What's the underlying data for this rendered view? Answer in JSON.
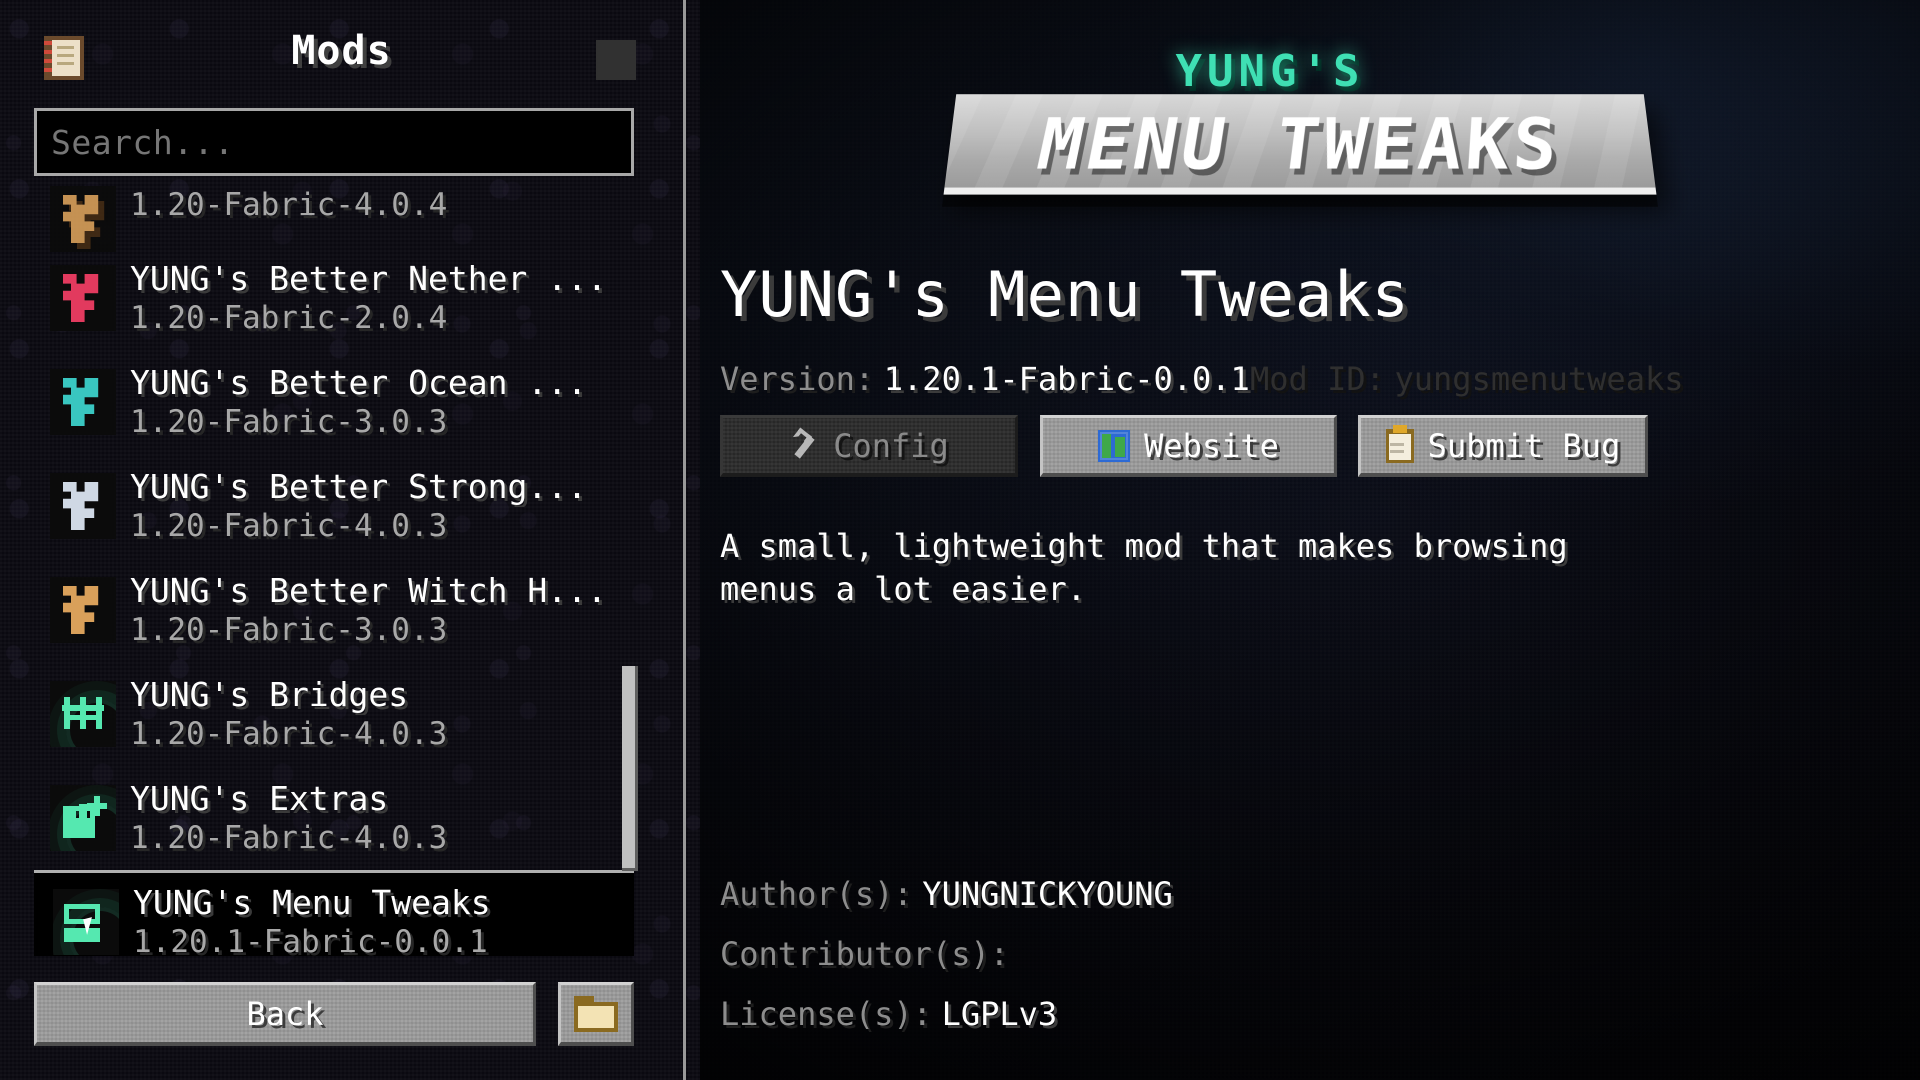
{
  "sidebar": {
    "title": "Mods",
    "book_icon": "book-icon",
    "header_toggle": "toggle-button",
    "search": {
      "placeholder": "Search...",
      "value": ""
    },
    "partial_top_row": {
      "version": "1.20-Fabric-4.0.4"
    },
    "mods": [
      {
        "name": "YUNG's Better Nether ...",
        "version": "1.20-Fabric-2.0.4",
        "icon": "yung-logo-icon",
        "c1": "#e23a5e",
        "c2": "#7d1028",
        "selected": false
      },
      {
        "name": "YUNG's Better Ocean ...",
        "version": "1.20-Fabric-3.0.3",
        "icon": "yung-logo-icon",
        "c1": "#39c6c0",
        "c2": "#12575c",
        "selected": false
      },
      {
        "name": "YUNG's Better Strong...",
        "version": "1.20-Fabric-4.0.3",
        "icon": "yung-logo-icon",
        "c1": "#cfd8e4",
        "c2": "#5a6a80",
        "selected": false
      },
      {
        "name": "YUNG's Better Witch H...",
        "version": "1.20-Fabric-3.0.3",
        "icon": "yung-logo-icon",
        "c1": "#d9a05a",
        "c2": "#74481e",
        "selected": false
      },
      {
        "name": "YUNG's Bridges",
        "version": "1.20-Fabric-4.0.3",
        "icon": "bridge-icon",
        "c1": "#55e8b0",
        "c2": "#1a6b50",
        "selected": false
      },
      {
        "name": "YUNG's Extras",
        "version": "1.20-Fabric-4.0.3",
        "icon": "extras-icon",
        "c1": "#55e8b0",
        "c2": "#1a6b50",
        "selected": false
      },
      {
        "name": "YUNG's Menu Tweaks",
        "version": "1.20.1-Fabric-0.0.1",
        "icon": "menu-tweaks-icon",
        "c1": "#55e8b0",
        "c2": "#1a6b50",
        "selected": true
      }
    ],
    "back_label": "Back",
    "folder_button": "open-mods-folder-button",
    "scrollbar": "vertical-scrollbar"
  },
  "detail": {
    "logo": {
      "top_text": "YUNG'S",
      "main_text": "MENU TWEAKS",
      "accent_color": "#3fe0b4"
    },
    "title": "YUNG's Menu Tweaks",
    "version_label": "Version:",
    "version_value": "1.20.1-Fabric-0.0.1",
    "modid_label": "Mod ID:",
    "modid_value": "yungsmenutweaks",
    "buttons": {
      "config": {
        "label": "Config",
        "icon": "wrench-icon",
        "disabled": true
      },
      "website": {
        "label": "Website",
        "icon": "globe-icon",
        "disabled": false
      },
      "submit_bug": {
        "label": "Submit Bug",
        "icon": "clipboard-icon",
        "disabled": false
      }
    },
    "description": "A small, lightweight mod that makes browsing menus a lot easier.",
    "credits": [
      {
        "label": "Author(s):",
        "value": "YUNGNICKYOUNG"
      },
      {
        "label": "Contributor(s):",
        "value": ""
      },
      {
        "label": "License(s):",
        "value": "LGPLv3"
      }
    ]
  }
}
